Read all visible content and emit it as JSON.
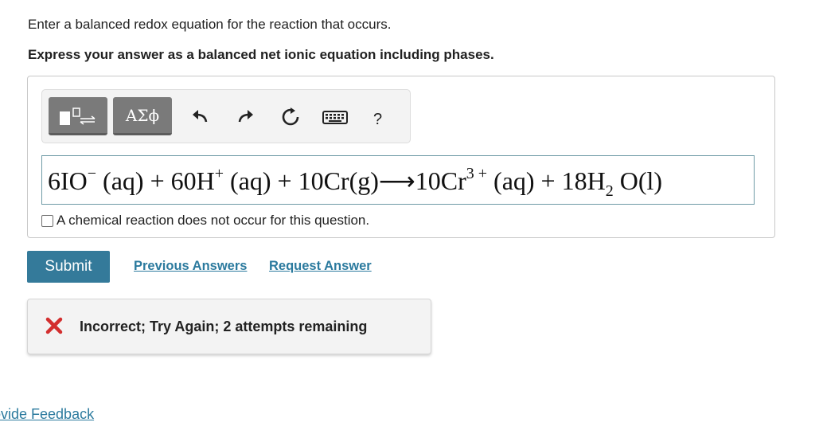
{
  "question": {
    "prompt": "Enter a balanced redox equation for the reaction that occurs.",
    "instruction": "Express your answer as a balanced net ionic equation including phases."
  },
  "toolbar": {
    "templates_icon": "templates-icon",
    "symbols_label": "ΑΣϕ",
    "undo_icon": "undo-icon",
    "redo_icon": "redo-icon",
    "reset_icon": "reset-icon",
    "keyboard_icon": "keyboard-icon",
    "help_label": "?"
  },
  "equation": {
    "c1": "6IO",
    "s1": "−",
    "p1": " (aq) + 60H",
    "s2": "+",
    "p2": " (aq) + 10Cr(g)⟶10Cr",
    "s3": "3 +",
    "p3": " (aq) + 18H",
    "sub1": "2",
    "p4": " O(l)"
  },
  "no_reaction": {
    "checked": false,
    "label": "A chemical reaction does not occur for this question."
  },
  "actions": {
    "submit": "Submit",
    "previous_answers": "Previous Answers",
    "request_answer": "Request Answer"
  },
  "feedback": {
    "message": "Incorrect; Try Again; 2 attempts remaining",
    "status_color": "#d32f2f"
  },
  "footer": {
    "provide_feedback": "ovide Feedback"
  }
}
